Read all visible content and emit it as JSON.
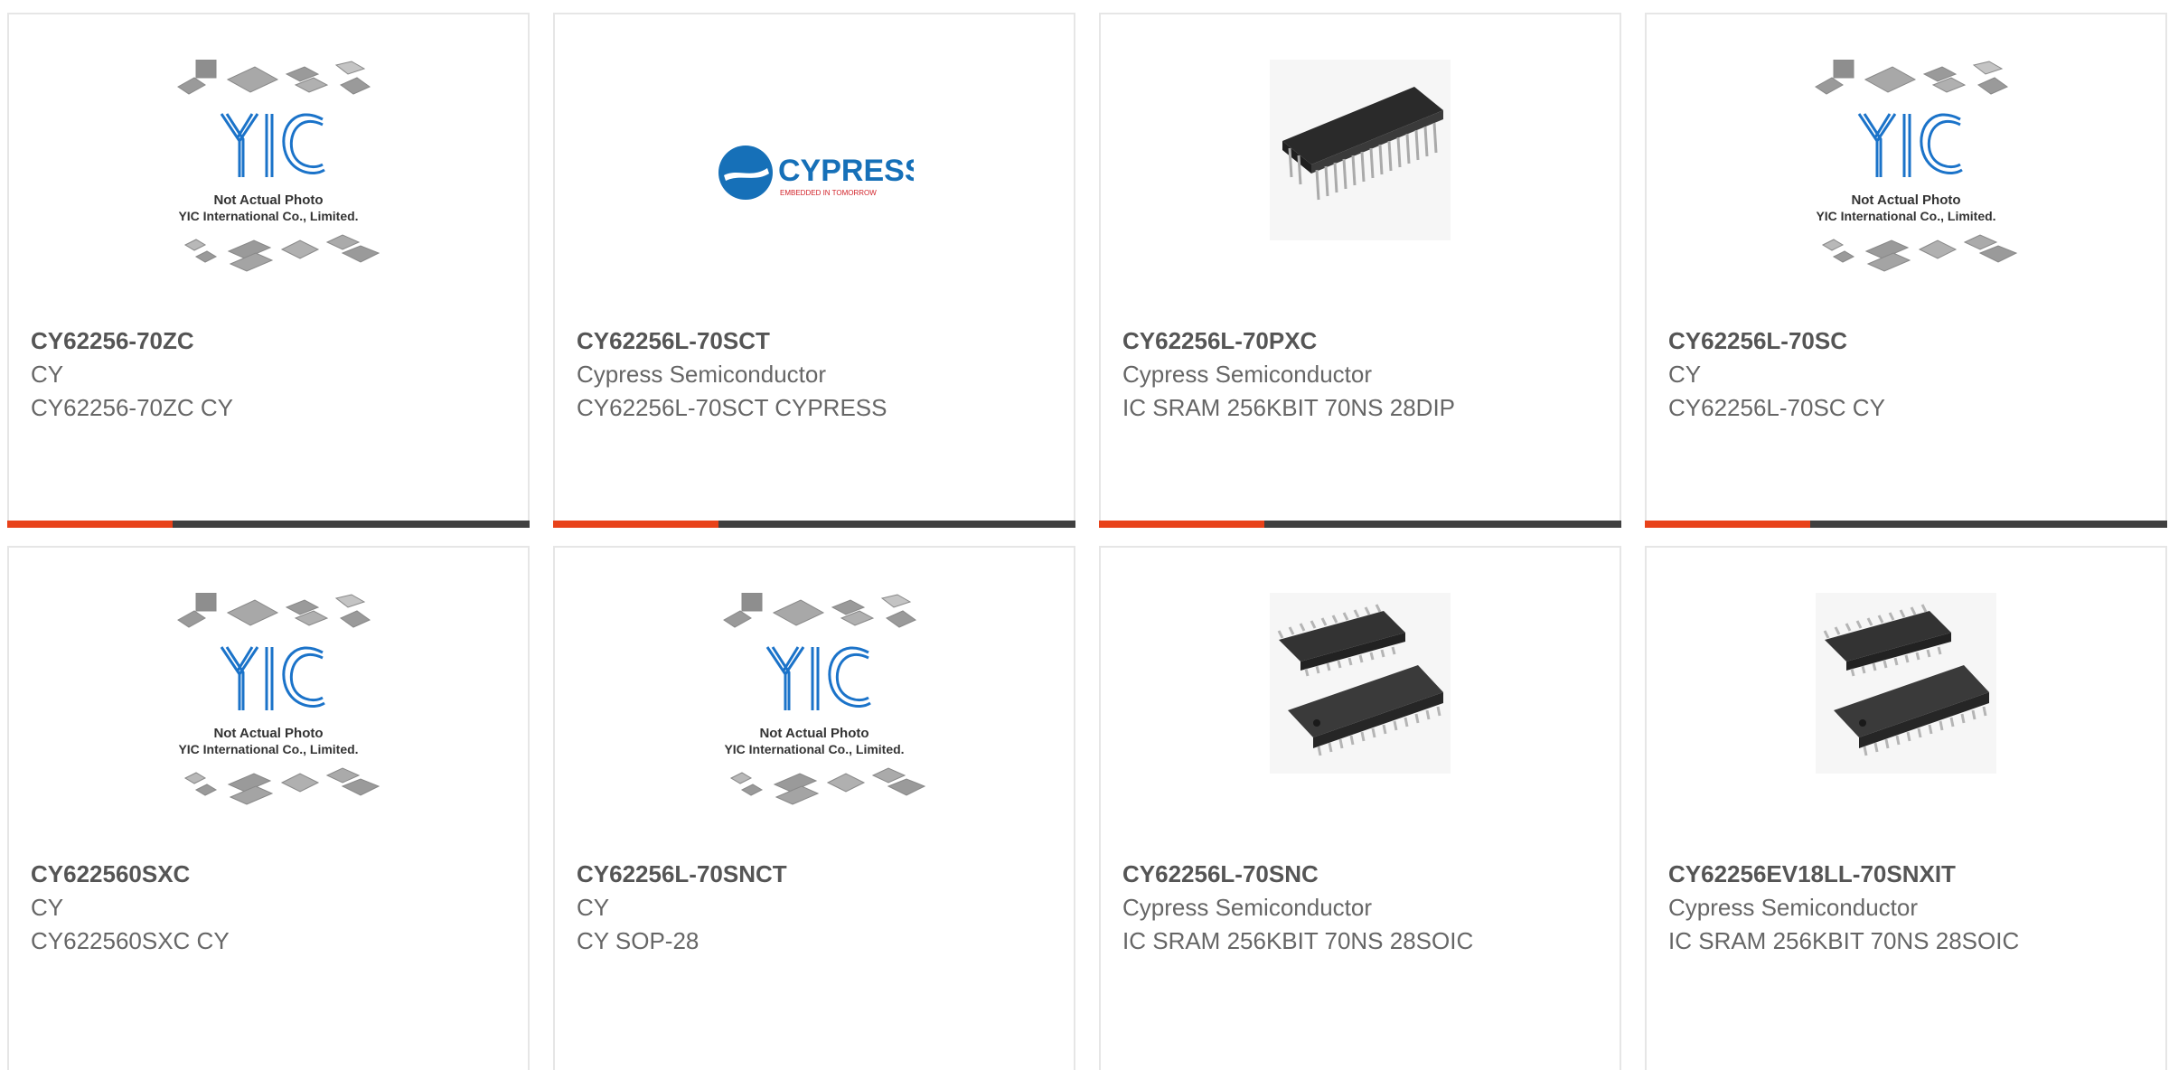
{
  "colors": {
    "accent": "#e8421a",
    "bar": "#404040",
    "border": "#e6e6e6",
    "part_number": "#555555",
    "text": "#666666",
    "yic_blue": "#1b73c9"
  },
  "placeholder": {
    "line1": "Not Actual Photo",
    "line2": "YIC International Co., Limited.",
    "logo": "YIC"
  },
  "cypress_logo": {
    "name": "CYPRESS",
    "tagline": "EMBEDDED IN TOMORROW"
  },
  "products": [
    {
      "part_number": "CY62256-70ZC",
      "manufacturer": "CY",
      "description": "CY62256-70ZC CY",
      "image": "yic-placeholder"
    },
    {
      "part_number": "CY62256L-70SCT",
      "manufacturer": "Cypress Semiconductor",
      "description": "CY62256L-70SCT CYPRESS",
      "image": "cypress-logo"
    },
    {
      "part_number": "CY62256L-70PXC",
      "manufacturer": "Cypress Semiconductor",
      "description": "IC SRAM 256KBIT 70NS 28DIP",
      "image": "dip-chip"
    },
    {
      "part_number": "CY62256L-70SC",
      "manufacturer": "CY",
      "description": "CY62256L-70SC CY",
      "image": "yic-placeholder"
    },
    {
      "part_number": "CY622560SXC",
      "manufacturer": "CY",
      "description": "CY622560SXC CY",
      "image": "yic-placeholder"
    },
    {
      "part_number": "CY62256L-70SNCT",
      "manufacturer": "CY",
      "description": "CY SOP-28",
      "image": "yic-placeholder"
    },
    {
      "part_number": "CY62256L-70SNC",
      "manufacturer": "Cypress Semiconductor",
      "description": "IC SRAM 256KBIT 70NS 28SOIC",
      "image": "soic-chips"
    },
    {
      "part_number": "CY62256EV18LL-70SNXIT",
      "manufacturer": "Cypress Semiconductor",
      "description": "IC SRAM 256KBIT 70NS 28SOIC",
      "image": "soic-chips"
    }
  ]
}
